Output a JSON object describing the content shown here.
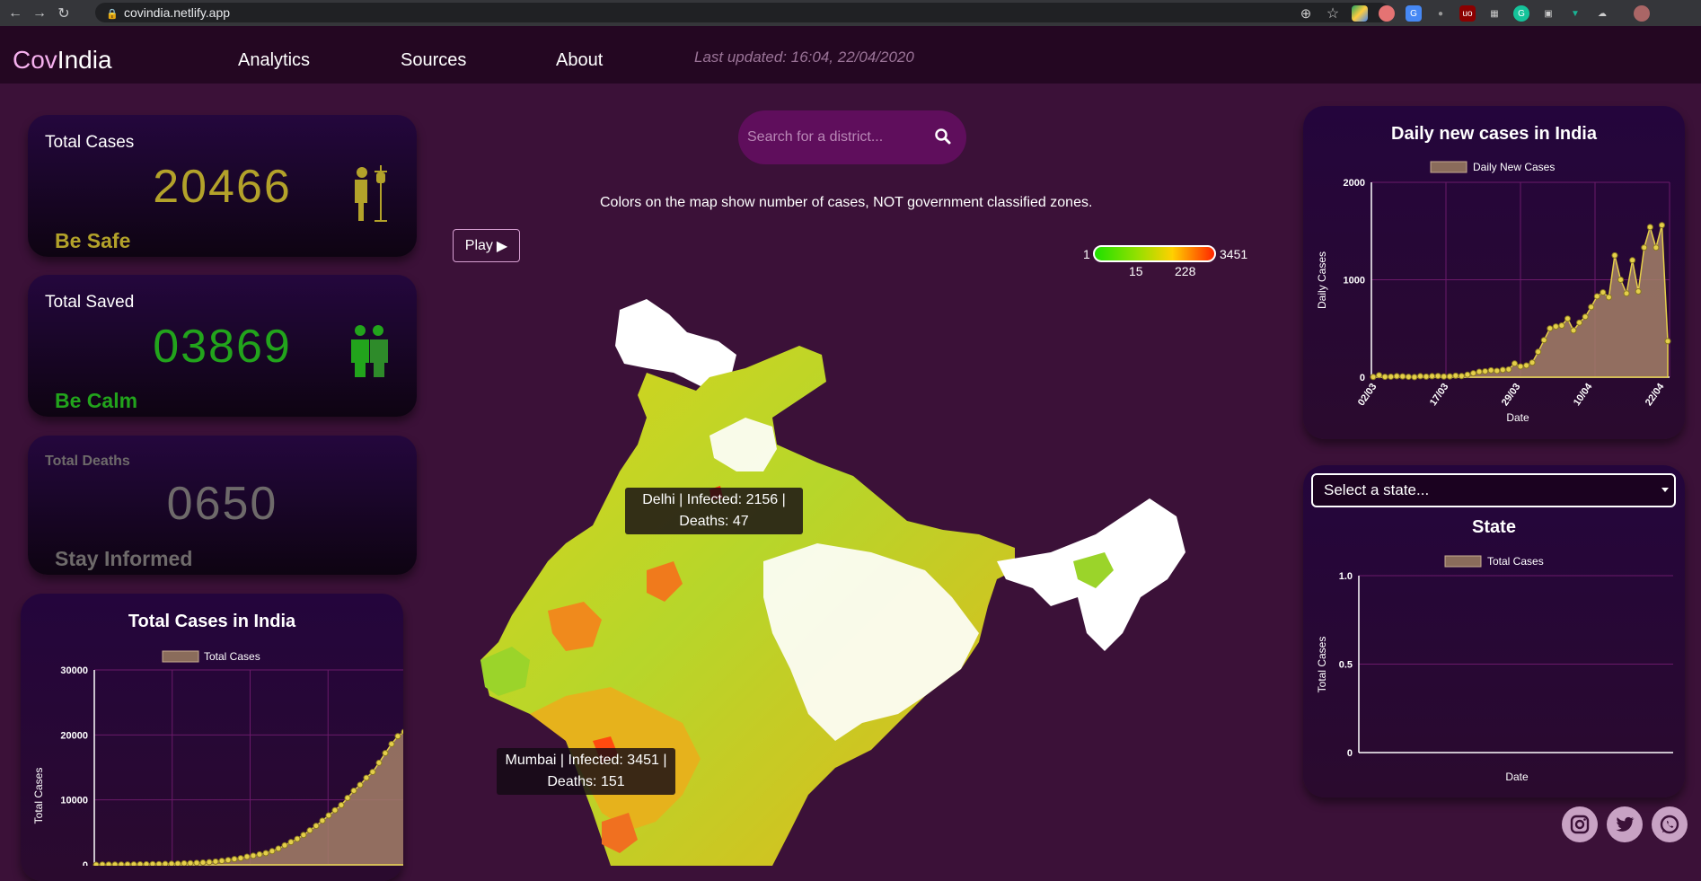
{
  "browser": {
    "url": "covindia.netlify.app"
  },
  "header": {
    "logo_a": "Cov",
    "logo_b": "India",
    "nav": [
      "Analytics",
      "Sources",
      "About"
    ],
    "last_updated": "Last updated: 16:04, 22/04/2020"
  },
  "stats": {
    "cases": {
      "title": "Total Cases",
      "value": "20466",
      "footer": "Be Safe",
      "color": "#b3a22a"
    },
    "saved": {
      "title": "Total Saved",
      "value": "03869",
      "footer": "Be Calm",
      "color": "#22a41c"
    },
    "deaths": {
      "title": "Total Deaths",
      "value": "0650",
      "footer": "Stay Informed",
      "color": "#6e6a6a"
    }
  },
  "search": {
    "placeholder": "Search for a district..."
  },
  "map": {
    "notice": "Colors on the map show number of cases, NOT government classified zones.",
    "play_label": "Play",
    "legend": {
      "min": "1",
      "max": "3451",
      "tick1": "15",
      "tick2": "228"
    },
    "tooltips": [
      {
        "line1": "Delhi | Infected: 2156 |",
        "line2": "Deaths: 47"
      },
      {
        "line1": "Mumbai | Infected: 3451 |",
        "line2": "Deaths: 151"
      }
    ]
  },
  "state": {
    "select_placeholder": "Select a state...",
    "title": "State"
  },
  "chart_data": [
    {
      "type": "area",
      "title": "Daily new cases in India",
      "legend": "Daily New Cases",
      "xlabel": "Date",
      "ylabel": "Daily Cases",
      "ylim": [
        0,
        2000
      ],
      "yticks": [
        "0",
        "1000",
        "2000"
      ],
      "xticks": [
        "02/03",
        "17/03",
        "29/03",
        "10/04",
        "22/04"
      ],
      "values": [
        2,
        20,
        4,
        5,
        10,
        8,
        4,
        1,
        10,
        6,
        10,
        12,
        7,
        8,
        15,
        12,
        25,
        40,
        55,
        60,
        70,
        65,
        75,
        80,
        140,
        110,
        120,
        150,
        260,
        380,
        500,
        520,
        530,
        600,
        480,
        560,
        620,
        720,
        830,
        870,
        820,
        1250,
        1000,
        860,
        1200,
        880,
        1330,
        1540,
        1330,
        1560,
        370
      ]
    },
    {
      "type": "area",
      "title": "Total Cases in India",
      "legend": "Total Cases",
      "xlabel": "",
      "ylabel": "Total Cases",
      "ylim": [
        0,
        30000
      ],
      "yticks": [
        "0",
        "10000",
        "20000",
        "30000"
      ],
      "values": [
        5,
        30,
        30,
        35,
        40,
        50,
        60,
        70,
        80,
        100,
        110,
        130,
        150,
        180,
        220,
        250,
        300,
        350,
        420,
        500,
        600,
        730,
        880,
        1020,
        1250,
        1400,
        1600,
        1800,
        2100,
        2500,
        3000,
        3500,
        4000,
        4600,
        5300,
        6000,
        6800,
        7600,
        8400,
        9200,
        10300,
        11400,
        12300,
        13400,
        14300,
        15700,
        17200,
        18600,
        19800,
        20466
      ]
    },
    {
      "type": "line",
      "title": "State",
      "legend": "Total Cases",
      "xlabel": "Date",
      "ylabel": "Total Cases",
      "ylim": [
        0,
        1.0
      ],
      "yticks": [
        "0",
        "0.5",
        "1.0"
      ],
      "values": []
    }
  ]
}
